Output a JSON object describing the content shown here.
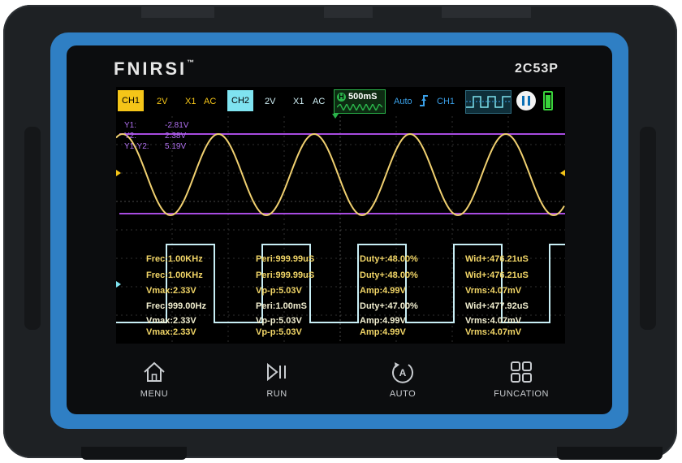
{
  "device": {
    "brand": "FNIRSI",
    "brand_mark": "™",
    "model": "2C53P"
  },
  "status_bar": {
    "ch1": {
      "label": "CH1",
      "volts": "2V",
      "probe": "X1",
      "coupling": "AC",
      "color": "#f5c518"
    },
    "ch2": {
      "label": "CH2",
      "volts": "2V",
      "probe": "X1",
      "coupling": "AC",
      "color": "#7fe3f0"
    },
    "timebase": {
      "marker": "H",
      "value": "500mS"
    },
    "trigger": {
      "mode": "Auto",
      "edge_icon": "rising-edge-icon",
      "source": "CH1"
    },
    "battery_level": 0.9
  },
  "cursors": {
    "y1": {
      "label": "Y1:",
      "value": "-2.81V"
    },
    "y2": {
      "label": "Y2:",
      "value": "2.38V"
    },
    "diff": {
      "label": "Y1-Y2:",
      "value": "5.19V"
    }
  },
  "measurements": [
    [
      "Frec:1.00KHz",
      "Peri:999.99uS",
      "Duty+:48.00%",
      "Wid+:476.21uS"
    ],
    [
      "Frec:1.00KHz",
      "Peri:999.99uS",
      "Duty+:48.00%",
      "Wid+:476.21uS"
    ],
    [
      "Vmax:2.33V",
      "Vp-p:5.03V",
      "Amp:4.99V",
      "Vrms:4.07mV"
    ],
    [
      "Frec:999.00Hz",
      "Peri:1.00mS",
      "Duty+:47.00%",
      "Wid+:477.92uS"
    ],
    [
      "Vmax:2.33V",
      "Vp-p:5.03V",
      "Amp:4.99V",
      "Vrms:4.07mV"
    ],
    [
      "Vmax:2.33V",
      "Vp-p:5.03V",
      "Amp:4.99V",
      "Vrms:4.07mV"
    ]
  ],
  "buttons": {
    "menu": "MENU",
    "run": "RUN",
    "auto": "AUTO",
    "function": "FUNCATION"
  },
  "colors": {
    "ch1_wave": "#f0d070",
    "ch2_wave": "#c8eef5",
    "cursor": "#a74be0",
    "frame_blue": "#2f7fc4"
  }
}
